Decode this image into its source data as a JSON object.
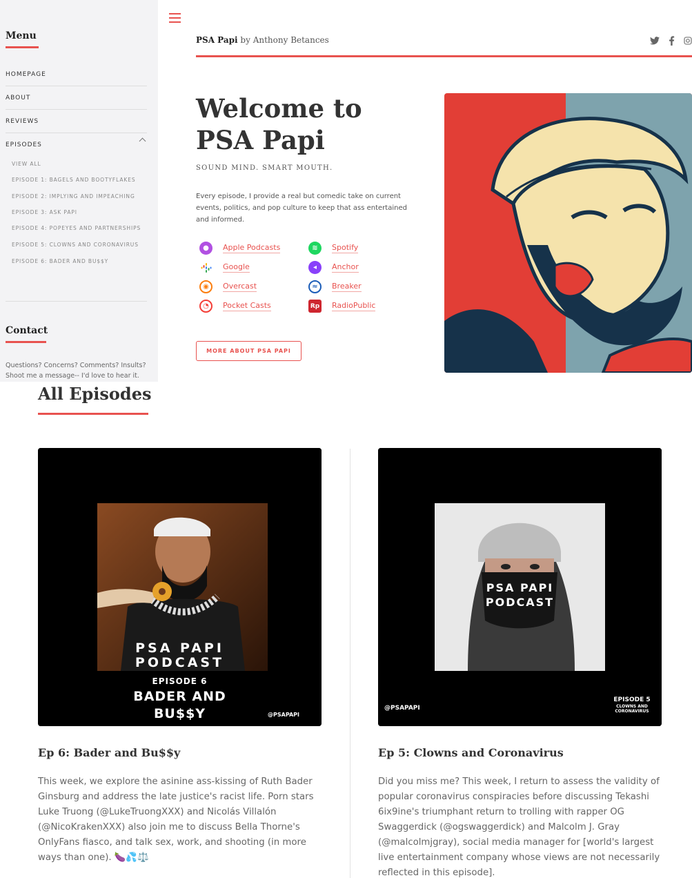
{
  "sidebar": {
    "menu_heading": "Menu",
    "nav": [
      {
        "label": "Homepage"
      },
      {
        "label": "About"
      },
      {
        "label": "Reviews"
      },
      {
        "label": "Episodes"
      }
    ],
    "episodes_sub": [
      "View All",
      "Episode 1: Bagels and Bootyflakes",
      "Episode 2: Implying and Impeaching",
      "Episode 3: Ask Papi",
      "Episode 4: Popeyes and Partnerships",
      "Episode 5: Clowns and Coronavirus",
      "Episode 6: Bader and Bu$$y"
    ],
    "contact_heading": "Contact",
    "contact_text": "Questions? Concerns? Comments? Insults? Shoot me a message-- I'd love to hear it."
  },
  "header": {
    "site_name": "PSA Papi",
    "byline": " by Anthony Betances",
    "social_icons": [
      "twitter-icon",
      "facebook-icon",
      "instagram-icon"
    ]
  },
  "hero": {
    "title": "Welcome to PSA Papi",
    "tagline": "SOUND MIND. SMART MOUTH.",
    "intro": "Every episode, I provide a real but comedic take on current events, politics, and pop culture to keep that ass entertained and informed.",
    "platforms": [
      {
        "label": "Apple Podcasts",
        "icon": "apple-podcasts-icon",
        "color": "#b150e2"
      },
      {
        "label": "Spotify",
        "icon": "spotify-icon",
        "color": "#1ed760"
      },
      {
        "label": "Google",
        "icon": "google-podcasts-icon",
        "color": "#4285f4"
      },
      {
        "label": "Anchor",
        "icon": "anchor-icon",
        "color": "#8940fa"
      },
      {
        "label": "Overcast",
        "icon": "overcast-icon",
        "color": "#fc7e0f"
      },
      {
        "label": "Breaker",
        "icon": "breaker-icon",
        "color": "#1c5db8"
      },
      {
        "label": "Pocket Casts",
        "icon": "pocket-casts-icon",
        "color": "#f43e37"
      },
      {
        "label": "RadioPublic",
        "icon": "radiopublic-icon",
        "color": "#ce262f"
      }
    ],
    "more_button": "MORE ABOUT PSA PAPI"
  },
  "episodes": {
    "heading": "All Episodes",
    "items": [
      {
        "title": "Ep 6: Bader and Bu$$y",
        "cover_line1": "PSA PAPI",
        "cover_line2": "PODCAST",
        "cover_episode": "EPISODE 6",
        "cover_title1": "BADER AND",
        "cover_title2": "BU$$Y",
        "cover_handle": "@PSAPAPI",
        "description": "This week, we explore the asinine ass-kissing of Ruth Bader Ginsburg and address the late justice's racist life. Porn stars Luke Truong (@LukeTruongXXX) and Nicolás Villalón (@NicoKrakenXXX) also join me to discuss Bella Thorne's OnlyFans fiasco, and talk sex, work, and shooting (in more ways than one). 🍆💦⚖️"
      },
      {
        "title": "Ep 5: Clowns and Coronavirus",
        "cover_line1": "PSA PAPI",
        "cover_line2": "PODCAST",
        "cover_episode": "EPISODE 5",
        "cover_sub1": "CLOWNS AND",
        "cover_sub2": "CORONAVIRUS",
        "cover_handle": "@PSAPAPI",
        "description": "Did you miss me? This week, I return to assess the validity of popular coronavirus conspiracies before discussing Tekashi 6ix9ine's triumphant return to trolling with rapper OG Swaggerdick (@ogswaggerdick) and Malcolm J. Gray (@malcolmjgray), social media manager for [world's largest live entertainment company whose views are not necessarily reflected in this episode]."
      }
    ]
  }
}
